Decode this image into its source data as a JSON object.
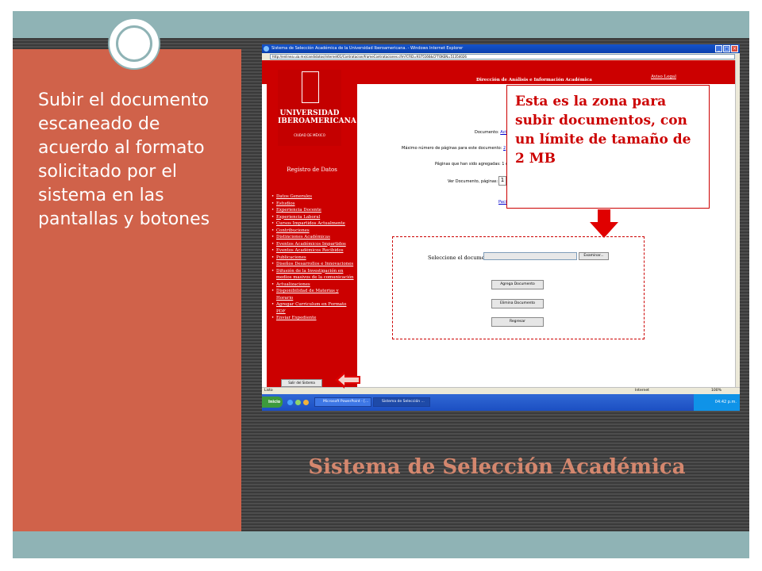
{
  "slide": {
    "body_text": "Subir el documento escaneado de acuerdo al formato solicitado por el sistema en las pantallas y botones",
    "title": "Sistema de Selección  Académica",
    "colors": {
      "left_panel": "#d0624a",
      "frame": "#8fb3b5",
      "title": "#d4876e",
      "callout": "#cc0000"
    }
  },
  "callout": {
    "text": "Esta es la zona para subir documentos, con un límite de tamaño de 2 MB"
  },
  "browser": {
    "window_title": "Sistema de Selección Académica de la Universidad Iberoamericana. - Windows Internet Explorer",
    "address": "http://enlinea.uia.mx/candidatos/internet01/Contratacion/frameContrataciones.cfm?CFID=9375166&CFTOKEN=51354026",
    "status_left": "Listo",
    "status_zone": "Internet",
    "status_zoom": "100%"
  },
  "site": {
    "header_title": "Dirección de Análisis e Información Académica",
    "aviso_legal": "Aviso Legal",
    "logo_name": "UNIVERSIDAD IBEROAMERICANA",
    "logo_city": "CIUDAD DE MÉXICO",
    "registro": "Registro de Datos",
    "menu": [
      "Datos Generales",
      "Estudios",
      "Experiencia Docente",
      "Experiencia Laboral",
      "Cursos Impartidos Actualmente",
      "Contribuciones",
      "Distinciones Académicas",
      "Eventos Académicos Impartidos",
      "Eventos Académicos Recibidos",
      "Publicaciones",
      "Diseños Desarrollos e Innovaciones",
      "Difusión de la Investigación en medios masivos de la comunicación",
      "Actualizaciones",
      "Disponibilidad de Materias y Horario",
      "Agregar Curriculum en Formato PDF",
      "Enviar Expediente"
    ],
    "salir": "Salir del Sistema"
  },
  "documento": {
    "documento_label": "Documento:",
    "documento_value": "Acta",
    "max_label": "Máximo número de páginas para este documento:",
    "max_value": "2",
    "agregadas_label": "Páginas que han sido agregadas: 1 de",
    "ver_label": "Ver Documento, páginas:",
    "ver_value": "1",
    "pag_link": "Paci"
  },
  "upload": {
    "select_label": "Seleccione el documento:",
    "browse": "Examinar...",
    "add": "Agrega Documento",
    "delete": "Elimina Documento",
    "back": "Regresar"
  },
  "taskbar": {
    "start": "Inicio",
    "item1": "Microsoft PowerPoint - [...",
    "item2": "Sistema de Selección ...",
    "clock": "04:42 p.m."
  }
}
